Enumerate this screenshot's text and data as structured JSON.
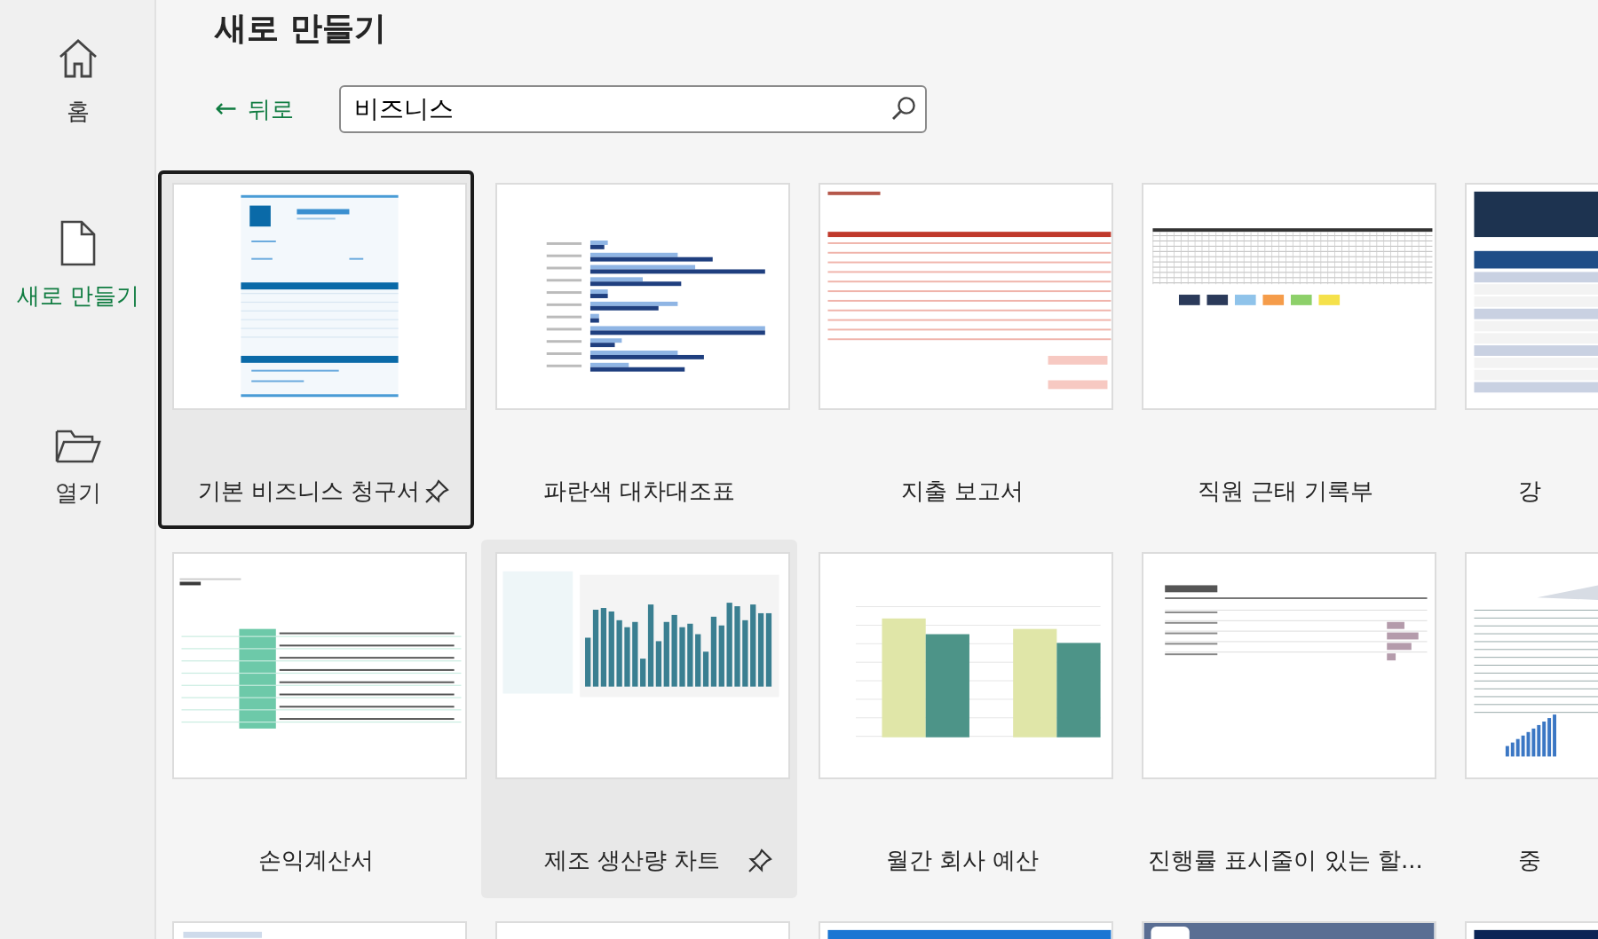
{
  "sidebar": {
    "items": [
      {
        "label": "홈",
        "selected": false
      },
      {
        "label": "새로 만들기",
        "selected": true
      },
      {
        "label": "열기",
        "selected": false
      }
    ]
  },
  "page_title": "새로 만들기",
  "back_link": {
    "arrow": "←",
    "label": "뒤로"
  },
  "search": {
    "value": "비즈니스"
  },
  "templates": [
    {
      "name": "기본 비즈니스 청구서",
      "kind": "invoice",
      "selected": true,
      "hovered": false
    },
    {
      "name": "파란색 대차대조표",
      "kind": "hbar",
      "selected": false,
      "hovered": false
    },
    {
      "name": "지출 보고서",
      "kind": "report",
      "selected": false,
      "hovered": false
    },
    {
      "name": "직원 근태 기록부",
      "kind": "grid",
      "selected": false,
      "hovered": false
    },
    {
      "name": "강",
      "kind": "inventory",
      "selected": false,
      "hovered": false
    },
    {
      "name": "손익계산서",
      "kind": "sparkline",
      "selected": false,
      "hovered": false
    },
    {
      "name": "제조 생산량 차트",
      "kind": "columns",
      "selected": false,
      "hovered": true
    },
    {
      "name": "월간 회사 예산",
      "kind": "budget",
      "selected": false,
      "hovered": false
    },
    {
      "name": "진행률 표시줄이 있는 할...",
      "kind": "todo",
      "selected": false,
      "hovered": false
    },
    {
      "name": "중",
      "kind": "loan",
      "selected": false,
      "hovered": false
    },
    {
      "kind": "pivot",
      "selected": false,
      "hovered": false
    },
    {
      "kind": "brownbars",
      "selected": false,
      "hovered": false
    },
    {
      "kind": "ytd",
      "selected": false,
      "hovered": false
    },
    {
      "kind": "banner",
      "selected": false,
      "hovered": false
    },
    {
      "kind": "darkbanner",
      "selected": false,
      "hovered": false
    }
  ]
}
